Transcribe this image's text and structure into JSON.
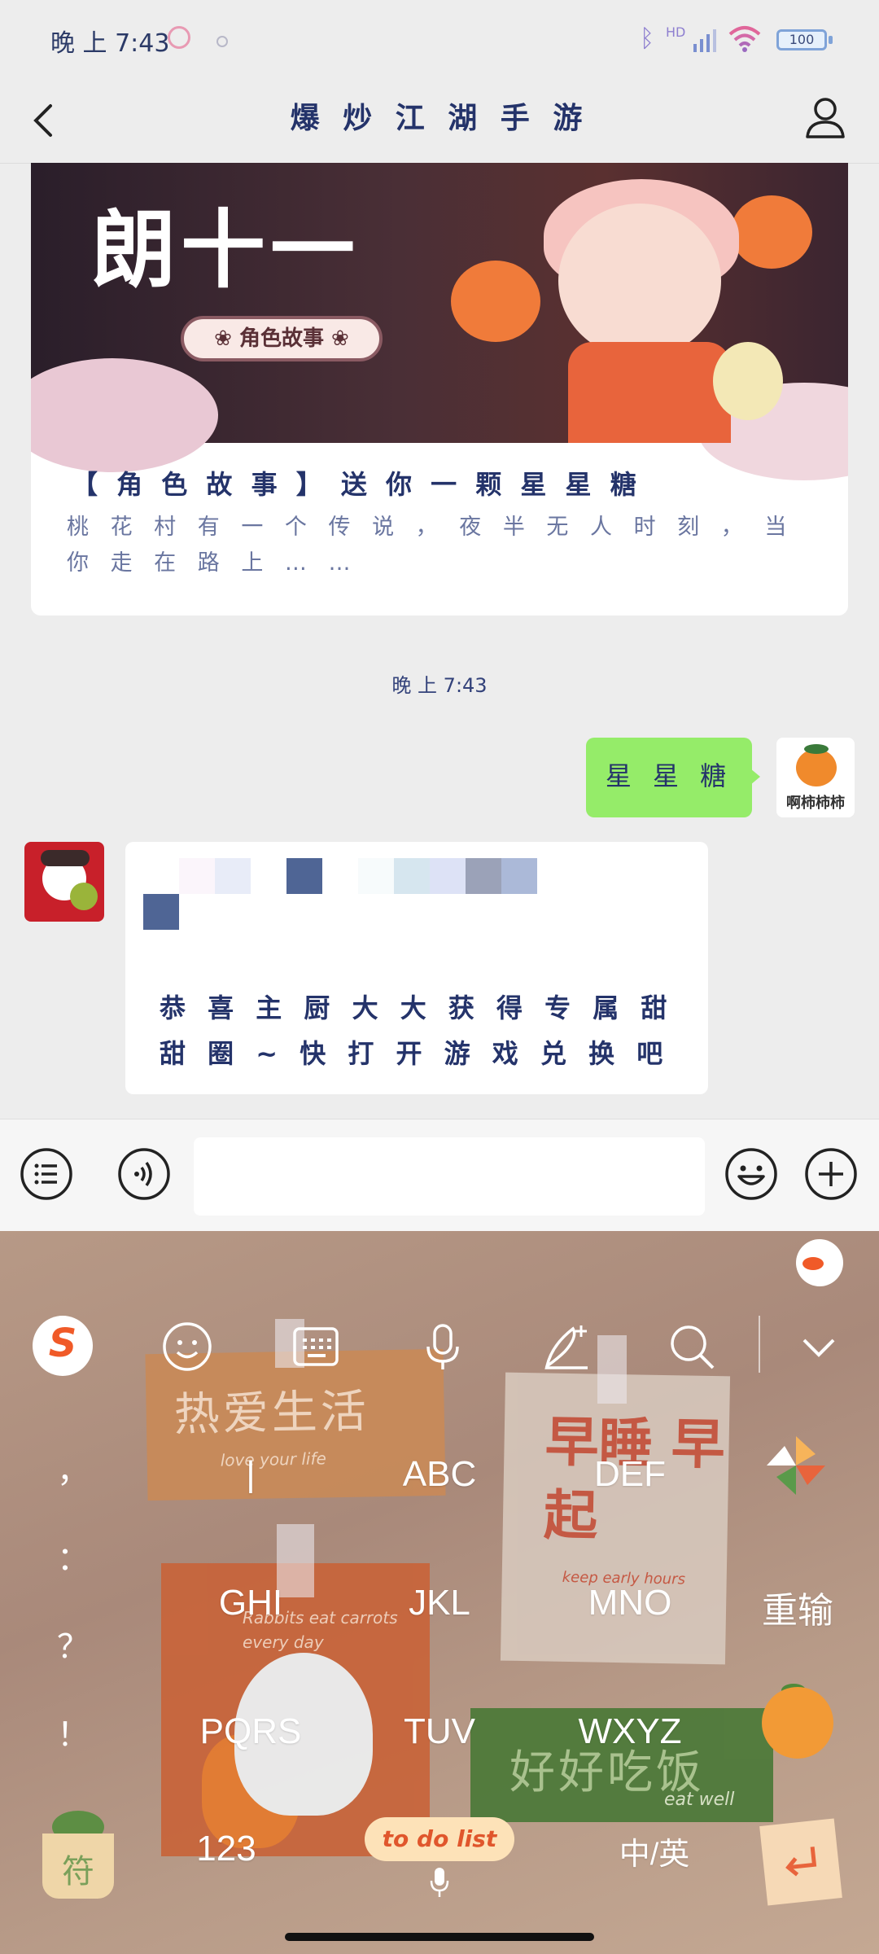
{
  "status_bar": {
    "time": "晚 上 7:43",
    "battery": "100",
    "hd_label": "HD"
  },
  "header": {
    "title": "爆 炒 江 湖 手 游"
  },
  "article": {
    "banner_title": "朗十一",
    "banner_tag": "❀ 角色故事 ❀",
    "headline": "【 角 色 故 事 】 送 你 一 颗 星 星 糖",
    "summary": "桃 花 村 有 一 个 传 说 ， 夜 半 无 人 时 刻 ， 当 你 走 在 路 上 … …"
  },
  "chat": {
    "timestamp": "晚 上 7:43",
    "sent": {
      "text": "星 星 糖",
      "avatar_label": "啊柿柿柿"
    },
    "received": {
      "text": "恭 喜 主 厨 大 大 获 得 专 属 甜 甜 圈 ~ 快 打 开 游 戏 兑 换 吧",
      "redacted_colors": [
        "#fbf5fb",
        "#e8ecf8",
        "#4f6595",
        "#f7fbfc",
        "#d6e6ef",
        "#dde2f6",
        "#9ba2b8",
        "#abb9d8",
        "#4f6595"
      ]
    }
  },
  "input_bar": {
    "placeholder": ""
  },
  "keyboard": {
    "toolbar_icons": [
      "sogou-logo",
      "emoji-icon",
      "keyboard-icon",
      "mic-icon",
      "handwriting-icon",
      "search-icon",
      "collapse-icon"
    ],
    "punctuation": [
      "，",
      "：",
      "？",
      "！"
    ],
    "keys": {
      "k1": "|",
      "k2": "ABC",
      "k3": "DEF",
      "k4": "GHI",
      "k5": "JKL",
      "k6": "MNO",
      "k7": "PQRS",
      "k8": "TUV",
      "k9": "WXYZ",
      "num": "123",
      "lang": "中/英",
      "retype": "重输",
      "symbol": "符"
    },
    "skin_text": {
      "note1": "热爱生活",
      "note1_sub": "love your life",
      "note2": "早睡 早起",
      "note2_sub": "keep early hours",
      "note3_sub": "Rabbits eat carrots every day",
      "note4": "好好吃饭",
      "note4_sub": "eat well",
      "todo": "to do list"
    }
  },
  "colors": {
    "sent_bubble": "#95ec69",
    "title_text": "#24336a",
    "keyboard_bg": "#b09382"
  }
}
